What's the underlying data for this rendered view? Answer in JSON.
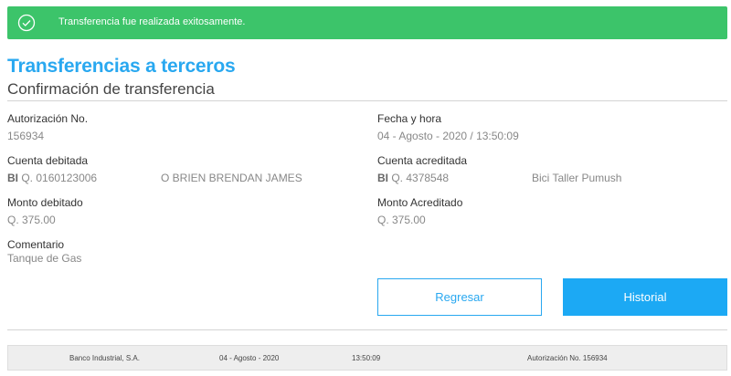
{
  "alert": {
    "message": "Transferencia fue realizada exitosamente.",
    "icon": "check-circle-icon",
    "color": "#3cc46a"
  },
  "header": {
    "title": "Transferencias a terceros",
    "subtitle": "Confirmación de transferencia"
  },
  "details": {
    "authorization": {
      "label": "Autorización No.",
      "value": "156934"
    },
    "datetime": {
      "label": "Fecha y hora",
      "value": "04 - Agosto - 2020 / 13:50:09"
    },
    "debited_account": {
      "label": "Cuenta debitada",
      "bank": "BI",
      "account": "Q. 0160123006",
      "holder": "O BRIEN BRENDAN JAMES"
    },
    "credited_account": {
      "label": "Cuenta acreditada",
      "bank": "BI",
      "account": "Q. 4378548",
      "holder": "Bici Taller Pumush"
    },
    "debited_amount": {
      "label": "Monto debitado",
      "value": "Q. 375.00"
    },
    "credited_amount": {
      "label": "Monto Acreditado",
      "value": "Q. 375.00"
    },
    "comment": {
      "label": "Comentario",
      "value": "Tanque de Gas"
    }
  },
  "buttons": {
    "back": "Regresar",
    "history": "Historial"
  },
  "footer": {
    "bank_name": "Banco Industrial, S.A.",
    "date": "04 - Agosto - 2020",
    "time": "13:50:09",
    "authorization": "Autorización No. 156934"
  },
  "colors": {
    "accent": "#29a8f0",
    "success": "#3cc46a"
  }
}
